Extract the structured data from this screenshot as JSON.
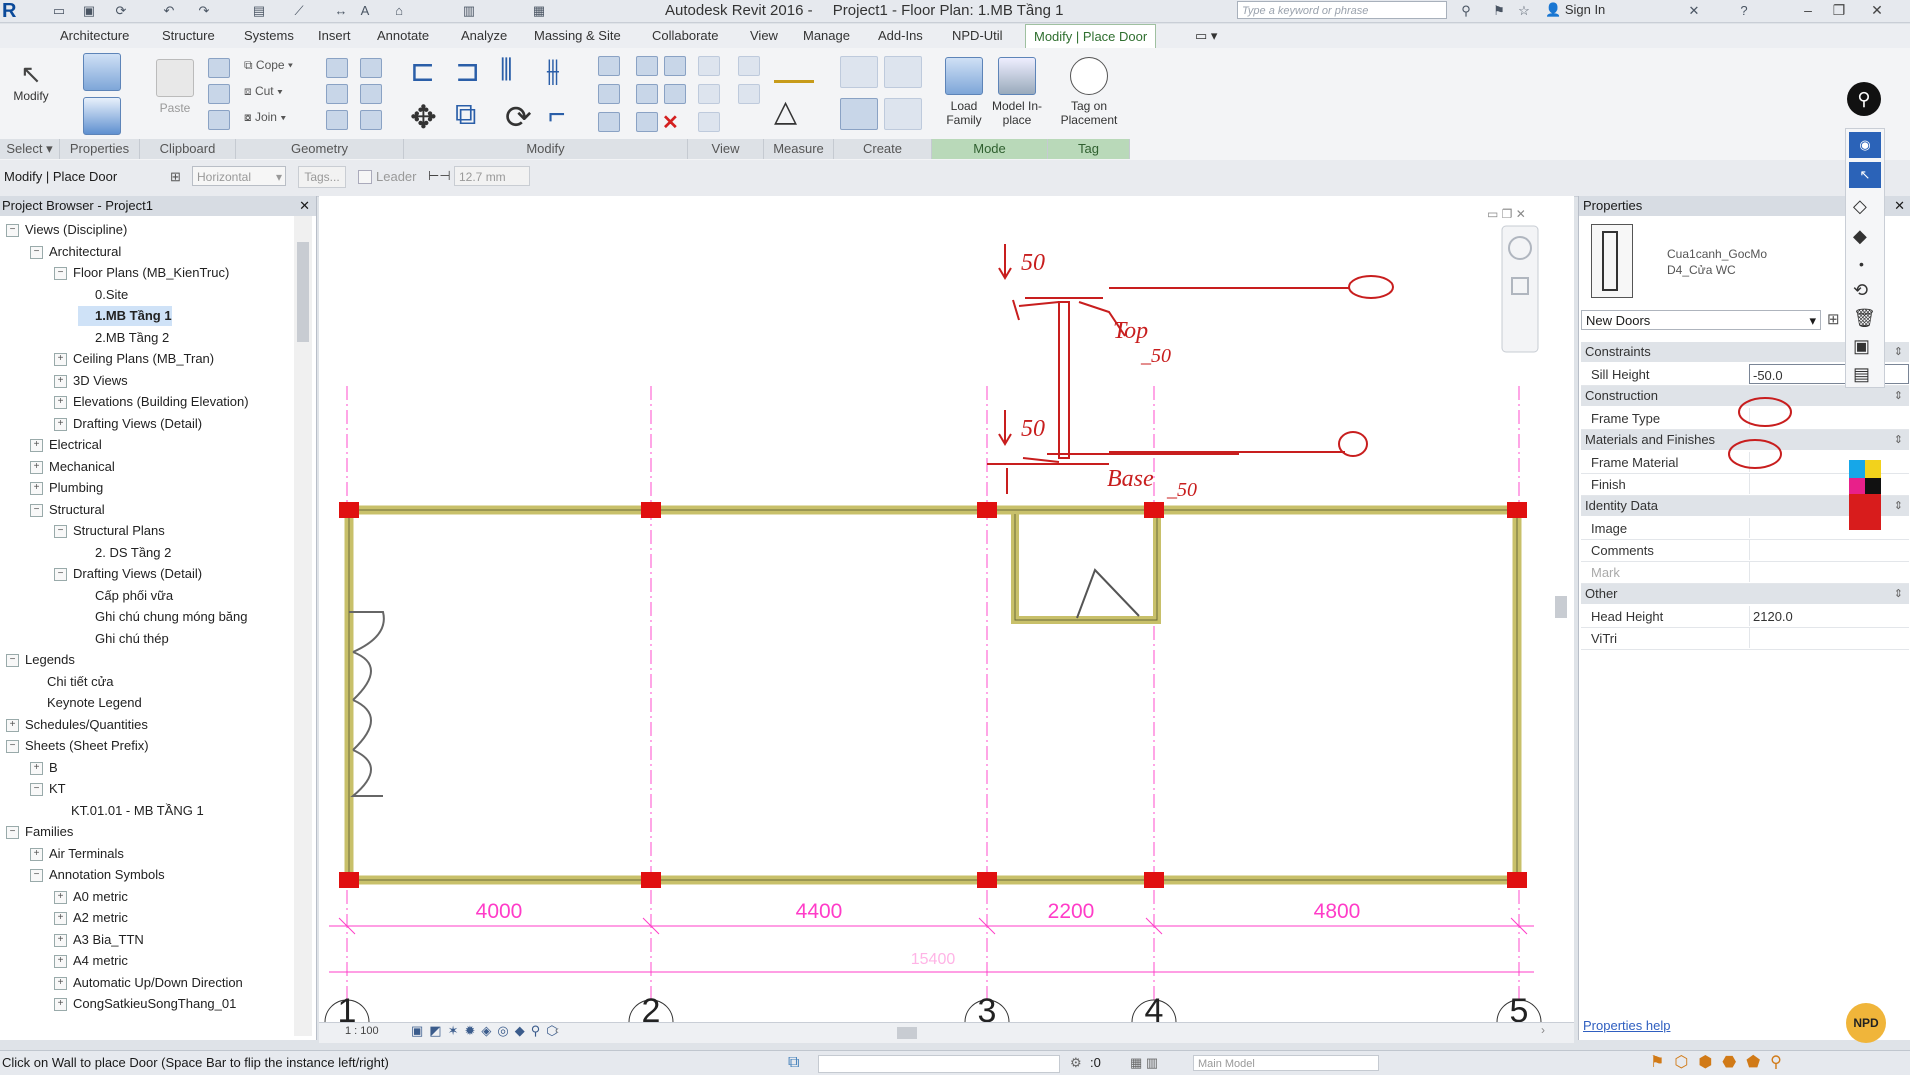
{
  "title_bar": {
    "app_name": "Autodesk Revit 2016 -",
    "document": "Project1 - Floor Plan: 1.MB Tầng 1",
    "search_placeholder": "Type a keyword or phrase",
    "sign_in": "Sign In"
  },
  "ribbon": {
    "tabs": [
      "Architecture",
      "Structure",
      "Systems",
      "Insert",
      "Annotate",
      "Analyze",
      "Massing & Site",
      "Collaborate",
      "View",
      "Manage",
      "Add-Ins",
      "NPD-Util",
      "Modify | Place Door"
    ],
    "panels": [
      "Select ▾",
      "Properties",
      "Clipboard",
      "Geometry",
      "Modify",
      "View",
      "Measure",
      "Create",
      "Mode",
      "Tag"
    ],
    "buttons": {
      "modify": "Modify",
      "paste": "Paste",
      "cope": "Cope",
      "cut": "Cut",
      "join": "Join",
      "load_family": "Load Family",
      "model_in_place": "Model In-place",
      "tag_on_placement": "Tag on Placement"
    }
  },
  "options_bar": {
    "context": "Modify | Place Door",
    "orientation": "Horizontal",
    "tags": "Tags...",
    "leader": "Leader",
    "leader_length": "12.7 mm"
  },
  "project_browser": {
    "title": "Project Browser - Project1",
    "items": [
      {
        "label": "Views (Discipline)",
        "level": 0,
        "exp": "-"
      },
      {
        "label": "Architectural",
        "level": 1,
        "exp": "-"
      },
      {
        "label": "Floor Plans (MB_KienTruc)",
        "level": 2,
        "exp": "-"
      },
      {
        "label": "0.Site",
        "level": 3,
        "exp": ""
      },
      {
        "label": "1.MB Tầng 1",
        "level": 3,
        "exp": "",
        "bold": true
      },
      {
        "label": "2.MB Tầng 2",
        "level": 3,
        "exp": ""
      },
      {
        "label": "Ceiling Plans (MB_Tran)",
        "level": 2,
        "exp": "+"
      },
      {
        "label": "3D Views",
        "level": 2,
        "exp": "+"
      },
      {
        "label": "Elevations (Building Elevation)",
        "level": 2,
        "exp": "+"
      },
      {
        "label": "Drafting Views (Detail)",
        "level": 2,
        "exp": "+"
      },
      {
        "label": "Electrical",
        "level": 1,
        "exp": "+"
      },
      {
        "label": "Mechanical",
        "level": 1,
        "exp": "+"
      },
      {
        "label": "Plumbing",
        "level": 1,
        "exp": "+"
      },
      {
        "label": "Structural",
        "level": 1,
        "exp": "-"
      },
      {
        "label": "Structural Plans",
        "level": 2,
        "exp": "-"
      },
      {
        "label": "2. DS Tầng 2",
        "level": 3,
        "exp": ""
      },
      {
        "label": "Drafting Views (Detail)",
        "level": 2,
        "exp": "-"
      },
      {
        "label": "Cấp phối vữa",
        "level": 3,
        "exp": ""
      },
      {
        "label": "Ghi chú chung móng băng",
        "level": 3,
        "exp": ""
      },
      {
        "label": "Ghi chú thép",
        "level": 3,
        "exp": ""
      },
      {
        "label": "Legends",
        "level": 0,
        "exp": "-"
      },
      {
        "label": "Chi tiết cửa",
        "level": 1,
        "exp": ""
      },
      {
        "label": "Keynote Legend",
        "level": 1,
        "exp": ""
      },
      {
        "label": "Schedules/Quantities",
        "level": 0,
        "exp": "+"
      },
      {
        "label": "Sheets (Sheet Prefix)",
        "level": 0,
        "exp": "-"
      },
      {
        "label": "B",
        "level": 1,
        "exp": "+"
      },
      {
        "label": "KT",
        "level": 1,
        "exp": "-"
      },
      {
        "label": "KT.01.01 - MB TẦNG 1",
        "level": 2,
        "exp": ""
      },
      {
        "label": "Families",
        "level": 0,
        "exp": "-"
      },
      {
        "label": "Air Terminals",
        "level": 1,
        "exp": "+"
      },
      {
        "label": "Annotation Symbols",
        "level": 1,
        "exp": "-"
      },
      {
        "label": "A0 metric",
        "level": 2,
        "exp": "+"
      },
      {
        "label": "A2 metric",
        "level": 2,
        "exp": "+"
      },
      {
        "label": "A3 Bia_TTN",
        "level": 2,
        "exp": "+"
      },
      {
        "label": "A4 metric",
        "level": 2,
        "exp": "+"
      },
      {
        "label": "Automatic Up/Down Direction",
        "level": 2,
        "exp": "+"
      },
      {
        "label": "CongSatkieuSongThang_01",
        "level": 2,
        "exp": "+"
      }
    ]
  },
  "drawing": {
    "dimensions": [
      "4000",
      "4400",
      "2200",
      "4800"
    ],
    "total_dimension": "15400",
    "grid_labels": [
      "1",
      "2",
      "3",
      "4",
      "5"
    ],
    "sketch_notes": [
      "50",
      "Top",
      "_50",
      "50",
      "Base",
      "_50"
    ],
    "scale": "1 : 100"
  },
  "properties": {
    "title": "Properties",
    "family_name": "Cua1canh_GocMo",
    "type_name": "D4_Cửa WC",
    "type_selector": "New Doors",
    "categories": [
      {
        "name": "Constraints",
        "rows": [
          {
            "name": "Sill Height",
            "value": "-50.0"
          }
        ]
      },
      {
        "name": "Construction",
        "rows": [
          {
            "name": "Frame Type",
            "value": ""
          }
        ]
      },
      {
        "name": "Materials and Finishes",
        "rows": [
          {
            "name": "Frame Material",
            "value": ""
          },
          {
            "name": "Finish",
            "value": ""
          }
        ]
      },
      {
        "name": "Identity Data",
        "rows": [
          {
            "name": "Image",
            "value": ""
          },
          {
            "name": "Comments",
            "value": ""
          },
          {
            "name": "Mark",
            "value": ""
          }
        ]
      },
      {
        "name": "Other",
        "rows": [
          {
            "name": "Head Height",
            "value": "2120.0"
          },
          {
            "name": "ViTri",
            "value": ""
          }
        ]
      }
    ],
    "help_link": "Properties help"
  },
  "status_bar": {
    "message": "Click on Wall to place Door (Space Bar to flip the instance left/right)",
    "workset_count": ":0",
    "model": "Main Model",
    "badge": "NPD"
  },
  "colors": {
    "accent_green": "#2f6f2f",
    "dimension_magenta": "#ff3cc8",
    "grid_magenta": "#ff6ad5",
    "sketch_red": "#c81e1e",
    "wall_red_marker": "#e01010"
  }
}
